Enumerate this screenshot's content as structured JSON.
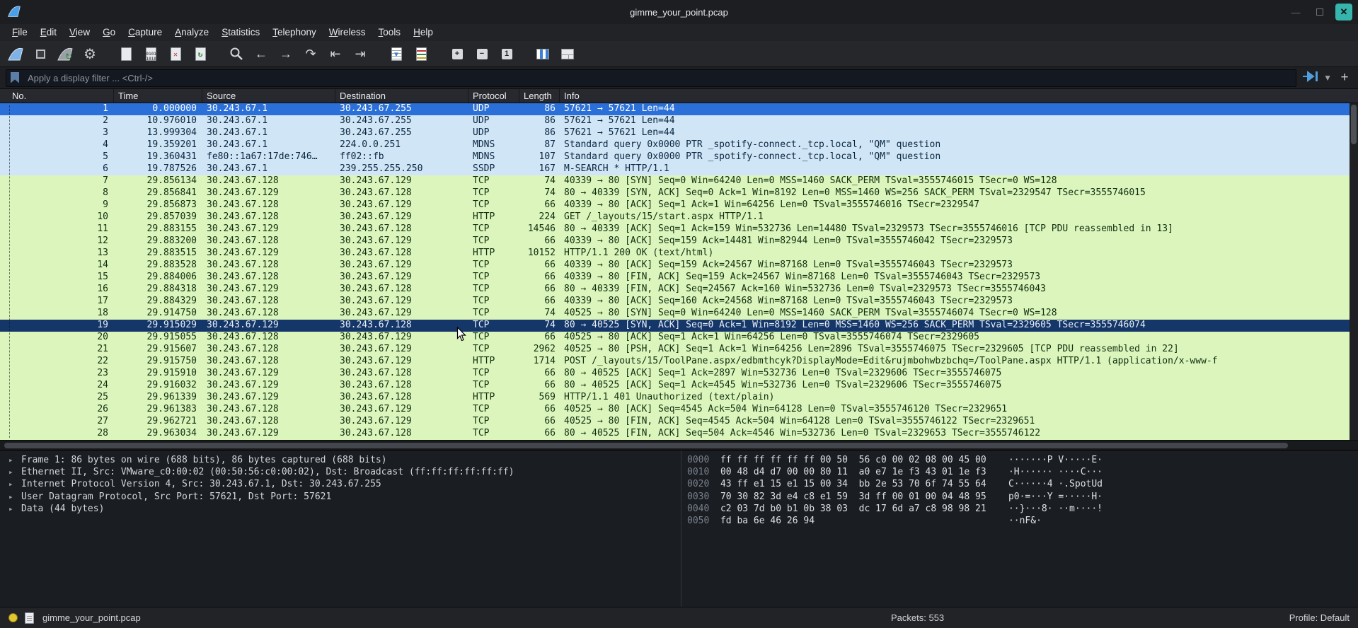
{
  "window": {
    "title": "gimme_your_point.pcap"
  },
  "menu": {
    "items": [
      "File",
      "Edit",
      "View",
      "Go",
      "Capture",
      "Analyze",
      "Statistics",
      "Telephony",
      "Wireless",
      "Tools",
      "Help"
    ]
  },
  "toolbar": {
    "icons": [
      "start-capture",
      "stop-capture",
      "restart-capture",
      "capture-options",
      "open-file",
      "save-file",
      "close-file",
      "reload-file",
      "find-packet",
      "go-back",
      "go-forward",
      "go-to-packet",
      "go-first",
      "go-last",
      "colorize-packets",
      "auto-scroll",
      "zoom-in",
      "zoom-out",
      "zoom-reset",
      "resize-columns",
      "layout"
    ]
  },
  "filter": {
    "placeholder": "Apply a display filter ... <Ctrl-/>"
  },
  "colors": {
    "accent_blue": "#4f9ee0",
    "close_button": "#35b5ac",
    "row_styles": {
      "sel": {
        "bg": "#2a70d8",
        "fg": "#ffffff"
      },
      "udp": {
        "bg": "#d0e5f6",
        "fg": "#0a2740"
      },
      "http": {
        "bg": "#dcf5bd",
        "fg": "#11300f"
      },
      "sel2": {
        "bg": "#143669",
        "fg": "#e9eef6"
      }
    }
  },
  "packet_list": {
    "columns": [
      "No.",
      "Time",
      "Source",
      "Destination",
      "Protocol",
      "Length",
      "Info"
    ],
    "rows": [
      {
        "no": "1",
        "time": "0.000000",
        "src": "30.243.67.1",
        "dst": "30.243.67.255",
        "proto": "UDP",
        "len": "86",
        "info": "57621 → 57621 Len=44",
        "style": "sel"
      },
      {
        "no": "2",
        "time": "10.976010",
        "src": "30.243.67.1",
        "dst": "30.243.67.255",
        "proto": "UDP",
        "len": "86",
        "info": "57621 → 57621 Len=44",
        "style": "udp"
      },
      {
        "no": "3",
        "time": "13.999304",
        "src": "30.243.67.1",
        "dst": "30.243.67.255",
        "proto": "UDP",
        "len": "86",
        "info": "57621 → 57621 Len=44",
        "style": "udp"
      },
      {
        "no": "4",
        "time": "19.359201",
        "src": "30.243.67.1",
        "dst": "224.0.0.251",
        "proto": "MDNS",
        "len": "87",
        "info": "Standard query 0x0000 PTR _spotify-connect._tcp.local, \"QM\" question",
        "style": "udp"
      },
      {
        "no": "5",
        "time": "19.360431",
        "src": "fe80::1a67:17de:746…",
        "dst": "ff02::fb",
        "proto": "MDNS",
        "len": "107",
        "info": "Standard query 0x0000 PTR _spotify-connect._tcp.local, \"QM\" question",
        "style": "udp"
      },
      {
        "no": "6",
        "time": "19.787526",
        "src": "30.243.67.1",
        "dst": "239.255.255.250",
        "proto": "SSDP",
        "len": "167",
        "info": "M-SEARCH * HTTP/1.1",
        "style": "udp"
      },
      {
        "no": "7",
        "time": "29.856134",
        "src": "30.243.67.128",
        "dst": "30.243.67.129",
        "proto": "TCP",
        "len": "74",
        "info": "40339 → 80 [SYN] Seq=0 Win=64240 Len=0 MSS=1460 SACK_PERM TSval=3555746015 TSecr=0 WS=128",
        "style": "http"
      },
      {
        "no": "8",
        "time": "29.856841",
        "src": "30.243.67.129",
        "dst": "30.243.67.128",
        "proto": "TCP",
        "len": "74",
        "info": "80 → 40339 [SYN, ACK] Seq=0 Ack=1 Win=8192 Len=0 MSS=1460 WS=256 SACK_PERM TSval=2329547 TSecr=3555746015",
        "style": "http"
      },
      {
        "no": "9",
        "time": "29.856873",
        "src": "30.243.67.128",
        "dst": "30.243.67.129",
        "proto": "TCP",
        "len": "66",
        "info": "40339 → 80 [ACK] Seq=1 Ack=1 Win=64256 Len=0 TSval=3555746016 TSecr=2329547",
        "style": "http"
      },
      {
        "no": "10",
        "time": "29.857039",
        "src": "30.243.67.128",
        "dst": "30.243.67.129",
        "proto": "HTTP",
        "len": "224",
        "info": "GET /_layouts/15/start.aspx HTTP/1.1 ",
        "style": "http"
      },
      {
        "no": "11",
        "time": "29.883155",
        "src": "30.243.67.129",
        "dst": "30.243.67.128",
        "proto": "TCP",
        "len": "14546",
        "info": "80 → 40339 [ACK] Seq=1 Ack=159 Win=532736 Len=14480 TSval=2329573 TSecr=3555746016 [TCP PDU reassembled in 13]",
        "style": "http"
      },
      {
        "no": "12",
        "time": "29.883200",
        "src": "30.243.67.128",
        "dst": "30.243.67.129",
        "proto": "TCP",
        "len": "66",
        "info": "40339 → 80 [ACK] Seq=159 Ack=14481 Win=82944 Len=0 TSval=3555746042 TSecr=2329573",
        "style": "http"
      },
      {
        "no": "13",
        "time": "29.883515",
        "src": "30.243.67.129",
        "dst": "30.243.67.128",
        "proto": "HTTP",
        "len": "10152",
        "info": "HTTP/1.1 200 OK  (text/html)",
        "style": "http"
      },
      {
        "no": "14",
        "time": "29.883528",
        "src": "30.243.67.128",
        "dst": "30.243.67.129",
        "proto": "TCP",
        "len": "66",
        "info": "40339 → 80 [ACK] Seq=159 Ack=24567 Win=87168 Len=0 TSval=3555746043 TSecr=2329573",
        "style": "http"
      },
      {
        "no": "15",
        "time": "29.884006",
        "src": "30.243.67.128",
        "dst": "30.243.67.129",
        "proto": "TCP",
        "len": "66",
        "info": "40339 → 80 [FIN, ACK] Seq=159 Ack=24567 Win=87168 Len=0 TSval=3555746043 TSecr=2329573",
        "style": "http"
      },
      {
        "no": "16",
        "time": "29.884318",
        "src": "30.243.67.129",
        "dst": "30.243.67.128",
        "proto": "TCP",
        "len": "66",
        "info": "80 → 40339 [FIN, ACK] Seq=24567 Ack=160 Win=532736 Len=0 TSval=2329573 TSecr=3555746043",
        "style": "http"
      },
      {
        "no": "17",
        "time": "29.884329",
        "src": "30.243.67.128",
        "dst": "30.243.67.129",
        "proto": "TCP",
        "len": "66",
        "info": "40339 → 80 [ACK] Seq=160 Ack=24568 Win=87168 Len=0 TSval=3555746043 TSecr=2329573",
        "style": "http"
      },
      {
        "no": "18",
        "time": "29.914750",
        "src": "30.243.67.128",
        "dst": "30.243.67.129",
        "proto": "TCP",
        "len": "74",
        "info": "40525 → 80 [SYN] Seq=0 Win=64240 Len=0 MSS=1460 SACK_PERM TSval=3555746074 TSecr=0 WS=128",
        "style": "http"
      },
      {
        "no": "19",
        "time": "29.915029",
        "src": "30.243.67.129",
        "dst": "30.243.67.128",
        "proto": "TCP",
        "len": "74",
        "info": "80 → 40525 [SYN, ACK] Seq=0 Ack=1 Win=8192 Len=0 MSS=1460 WS=256 SACK_PERM TSval=2329605 TSecr=3555746074",
        "style": "sel2"
      },
      {
        "no": "20",
        "time": "29.915055",
        "src": "30.243.67.128",
        "dst": "30.243.67.129",
        "proto": "TCP",
        "len": "66",
        "info": "40525 → 80 [ACK] Seq=1 Ack=1 Win=64256 Len=0 TSval=3555746074 TSecr=2329605",
        "style": "http"
      },
      {
        "no": "21",
        "time": "29.915607",
        "src": "30.243.67.128",
        "dst": "30.243.67.129",
        "proto": "TCP",
        "len": "2962",
        "info": "40525 → 80 [PSH, ACK] Seq=1 Ack=1 Win=64256 Len=2896 TSval=3555746075 TSecr=2329605 [TCP PDU reassembled in 22]",
        "style": "http"
      },
      {
        "no": "22",
        "time": "29.915750",
        "src": "30.243.67.128",
        "dst": "30.243.67.129",
        "proto": "HTTP",
        "len": "1714",
        "info": "POST /_layouts/15/ToolPane.aspx/edbmthcyk?DisplayMode=Edit&rujmbohwbzbchq=/ToolPane.aspx HTTP/1.1  (application/x-www-f",
        "style": "http"
      },
      {
        "no": "23",
        "time": "29.915910",
        "src": "30.243.67.129",
        "dst": "30.243.67.128",
        "proto": "TCP",
        "len": "66",
        "info": "80 → 40525 [ACK] Seq=1 Ack=2897 Win=532736 Len=0 TSval=2329606 TSecr=3555746075",
        "style": "http"
      },
      {
        "no": "24",
        "time": "29.916032",
        "src": "30.243.67.129",
        "dst": "30.243.67.128",
        "proto": "TCP",
        "len": "66",
        "info": "80 → 40525 [ACK] Seq=1 Ack=4545 Win=532736 Len=0 TSval=2329606 TSecr=3555746075",
        "style": "http"
      },
      {
        "no": "25",
        "time": "29.961339",
        "src": "30.243.67.129",
        "dst": "30.243.67.128",
        "proto": "HTTP",
        "len": "569",
        "info": "HTTP/1.1 401 Unauthorized  (text/plain)",
        "style": "http"
      },
      {
        "no": "26",
        "time": "29.961383",
        "src": "30.243.67.128",
        "dst": "30.243.67.129",
        "proto": "TCP",
        "len": "66",
        "info": "40525 → 80 [ACK] Seq=4545 Ack=504 Win=64128 Len=0 TSval=3555746120 TSecr=2329651",
        "style": "http"
      },
      {
        "no": "27",
        "time": "29.962721",
        "src": "30.243.67.128",
        "dst": "30.243.67.129",
        "proto": "TCP",
        "len": "66",
        "info": "40525 → 80 [FIN, ACK] Seq=4545 Ack=504 Win=64128 Len=0 TSval=3555746122 TSecr=2329651",
        "style": "http"
      },
      {
        "no": "28",
        "time": "29.963034",
        "src": "30.243.67.129",
        "dst": "30.243.67.128",
        "proto": "TCP",
        "len": "66",
        "info": "80 → 40525 [FIN, ACK] Seq=504 Ack=4546 Win=532736 Len=0 TSval=2329653 TSecr=3555746122",
        "style": "http"
      }
    ]
  },
  "details": {
    "lines": [
      "Frame 1: 86 bytes on wire (688 bits), 86 bytes captured (688 bits)",
      "Ethernet II, Src: VMware_c0:00:02 (00:50:56:c0:00:02), Dst: Broadcast (ff:ff:ff:ff:ff:ff)",
      "Internet Protocol Version 4, Src: 30.243.67.1, Dst: 30.243.67.255",
      "User Datagram Protocol, Src Port: 57621, Dst Port: 57621",
      "Data (44 bytes)"
    ]
  },
  "bytes": {
    "rows": [
      {
        "offset": "0000",
        "hex": "ff ff ff ff ff ff 00 50  56 c0 00 02 08 00 45 00",
        "ascii": "·······P V·····E·"
      },
      {
        "offset": "0010",
        "hex": "00 48 d4 d7 00 00 80 11  a0 e7 1e f3 43 01 1e f3",
        "ascii": "·H······ ····C···"
      },
      {
        "offset": "0020",
        "hex": "43 ff e1 15 e1 15 00 34  bb 2e 53 70 6f 74 55 64",
        "ascii": "C······4 ·.SpotUd"
      },
      {
        "offset": "0030",
        "hex": "70 30 82 3d e4 c8 e1 59  3d ff 00 01 00 04 48 95",
        "ascii": "p0·=···Y =·····H·"
      },
      {
        "offset": "0040",
        "hex": "c2 03 7d b0 b1 0b 38 03  dc 17 6d a7 c8 98 98 21",
        "ascii": "··}···8· ··m····!"
      },
      {
        "offset": "0050",
        "hex": "fd ba 6e 46 26 94",
        "ascii": "··nF&·"
      }
    ]
  },
  "statusbar": {
    "filename": "gimme_your_point.pcap",
    "packets": "Packets: 553",
    "profile": "Profile: Default"
  }
}
